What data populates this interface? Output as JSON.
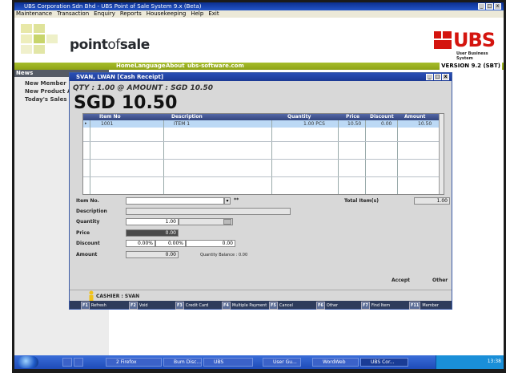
{
  "window": {
    "title": "UBS Corporation Sdn Bhd - UBS Point of Sale System 9.x (Beta)",
    "sys_buttons": [
      "_",
      "□",
      "x"
    ]
  },
  "menu": [
    "Maintenance",
    "Transaction",
    "Enquiry",
    "Reports",
    "Housekeeping",
    "Help",
    "Exit"
  ],
  "brand": {
    "name_bold": "point",
    "name_of": "of",
    "name_sale": "sale",
    "ubs": "UBS",
    "ubs_tagline": "User Business System",
    "version": "VERSION 9.2 (SBT)"
  },
  "nav": [
    "Home",
    "Language",
    "About",
    "ubs-software.com"
  ],
  "sidebar": {
    "header": "News",
    "items": [
      "New Member",
      "New Product Ar",
      "Today's Sales"
    ]
  },
  "dialog": {
    "title": "SVAN, LWAN [Cash Receipt]",
    "summary": "QTY : 1.00 @ AMOUNT : SGD 10.50",
    "total": "SGD 10.50",
    "grid": {
      "columns": [
        "Item No",
        "Description",
        "Quantity",
        "Price",
        "Discount",
        "Amount"
      ],
      "rows": [
        [
          "1001",
          "ITEM 1",
          "1.00 PCS",
          "10.50",
          "0.00",
          "10.50"
        ]
      ]
    },
    "fields": {
      "item_no_label": "Item No.",
      "description_label": "Description",
      "quantity_label": "Quantity",
      "quantity_value": "1.00",
      "price_label": "Price",
      "price_value": "0.00",
      "discount_label": "Discount",
      "discount_values": [
        "0.00%",
        "0.00%",
        "0.00"
      ],
      "amount_label": "Amount",
      "amount_value": "0.00",
      "qty_balance": "Quantity Balance : 0.00",
      "total_items_label": "Total Item(s)",
      "total_items_value": "1.00"
    },
    "accept_label": "Accept",
    "other_label": "Other",
    "cashier": "CASHIER : SVAN",
    "fkeys": [
      {
        "key": "F1",
        "label": "Refresh"
      },
      {
        "key": "F2",
        "label": "Void"
      },
      {
        "key": "F3",
        "label": "Credit Card"
      },
      {
        "key": "F4",
        "label": "Multiple Payment"
      },
      {
        "key": "F5",
        "label": "Cancel"
      },
      {
        "key": "F6",
        "label": "Other"
      },
      {
        "key": "F7",
        "label": "Find Item"
      },
      {
        "key": "F11",
        "label": "Member"
      }
    ]
  },
  "taskbar": {
    "tasks": [
      "2 Firefox",
      "Bum Disc...",
      "UBS",
      "User Gu...",
      "WordWeb",
      "UBS Cor..."
    ],
    "clock": "13:38"
  },
  "colors": {
    "nav_green": "#9bb01f",
    "ubs_red": "#d4140e",
    "dialog_title": "#2a4fb5",
    "grid_selected": "#bcd9f5"
  }
}
